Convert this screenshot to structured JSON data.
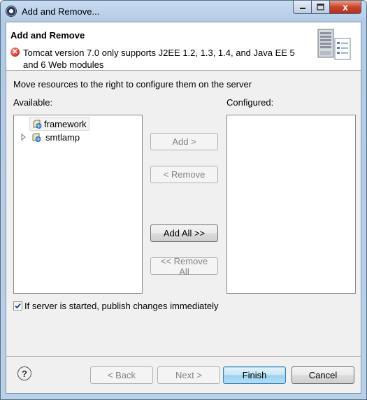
{
  "window": {
    "title": "Add and Remove...",
    "close_glyph": "x"
  },
  "header": {
    "title": "Add and Remove",
    "error_message": "Tomcat version 7.0 only supports J2EE 1.2, 1.3, 1.4, and Java EE 5 and 6 Web modules",
    "error_icon": "error-icon",
    "illustration_icon": "server-icon"
  },
  "instruction": "Move resources to the right to configure them on the server",
  "available": {
    "label": "Available:",
    "items": [
      {
        "label": "framework",
        "selected": true,
        "expandable": false
      },
      {
        "label": "smtlamp",
        "selected": false,
        "expandable": true
      }
    ]
  },
  "configured": {
    "label": "Configured:",
    "items": []
  },
  "buttons": {
    "add": "Add >",
    "remove": "< Remove",
    "add_all": "Add All >>",
    "remove_all": "<< Remove All"
  },
  "publish_checkbox": {
    "label": "If server is started, publish changes immediately",
    "checked": true
  },
  "footer": {
    "help": "?",
    "back": "< Back",
    "next": "Next >",
    "finish": "Finish",
    "cancel": "Cancel"
  }
}
